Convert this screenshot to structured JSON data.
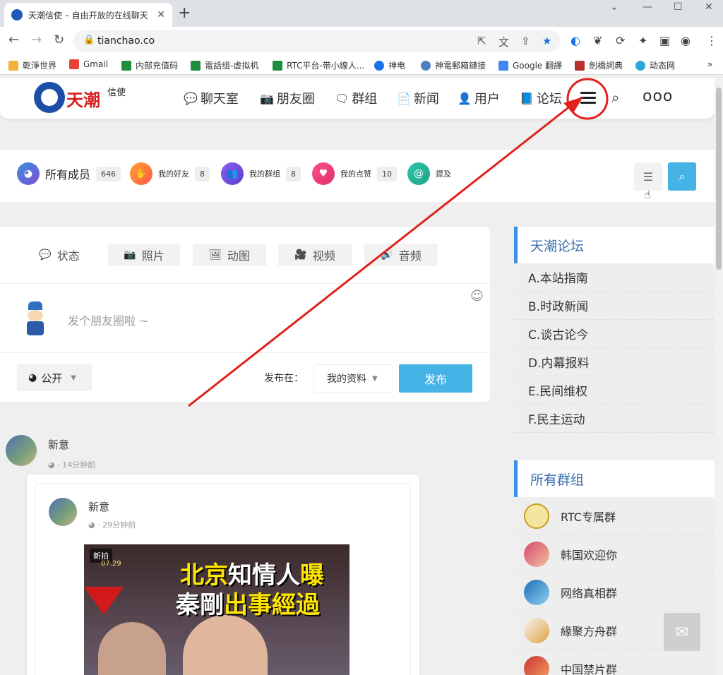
{
  "browser": {
    "tab_title": "天潮信使 – 自由开放的在线聊天",
    "url": "tianchao.co",
    "bookmarks": [
      "乾淨世界",
      "Gmail",
      "内部充值码",
      "電話组-虚拟机",
      "RTC平台-带小線人...",
      "神电",
      "神電郵箱鏈接",
      "Google 翻譯",
      "劍橋詞典",
      "动态网"
    ]
  },
  "site": {
    "logo_main": "天潮",
    "logo_sub": "信使",
    "nav": [
      "聊天室",
      "朋友圈",
      "群组",
      "新闻",
      "用户",
      "论坛"
    ],
    "more_label": "ooo"
  },
  "members_bar": {
    "all_members_label": "所有成员",
    "all_members_count": "646",
    "friends_label": "我的好友",
    "friends_count": "8",
    "groups_label": "我的群组",
    "groups_count": "8",
    "likes_label": "我的点赞",
    "likes_count": "10",
    "mentions_label": "提及"
  },
  "composer": {
    "tabs": [
      "状态",
      "照片",
      "动图",
      "视频",
      "音频"
    ],
    "placeholder": "发个朋友圈啦 ~",
    "privacy": "公开",
    "post_in_label": "发布在：",
    "post_in_value": "我的资料",
    "publish_label": "发布"
  },
  "feed": {
    "post_author": "新意",
    "post_time": "14分钟前",
    "shared_author": "新意",
    "shared_time": "29分钟前",
    "thumbnail": {
      "badge": "新拍",
      "date": "07.29",
      "headline1_a": "北京",
      "headline1_b": "知情人",
      "headline1_c": "曝",
      "headline2_a": "秦剛",
      "headline2_b": "出事經過"
    }
  },
  "sidebar": {
    "forum_title": "天潮论坛",
    "forum_items": [
      "A.本站指南",
      "B.时政新闻",
      "C.谈古论今",
      "D.内幕报料",
      "E.民间维权",
      "F.民主运动"
    ],
    "groups_title": "所有群组",
    "groups": [
      "RTC专属群",
      "韩国欢迎你",
      "网络真相群",
      "緣聚方舟群",
      "中国禁片群"
    ]
  },
  "colors": {
    "accent_blue": "#45b3e6",
    "sidebar_accent": "#3b8fe0",
    "annotation_red": "#e3201b"
  }
}
